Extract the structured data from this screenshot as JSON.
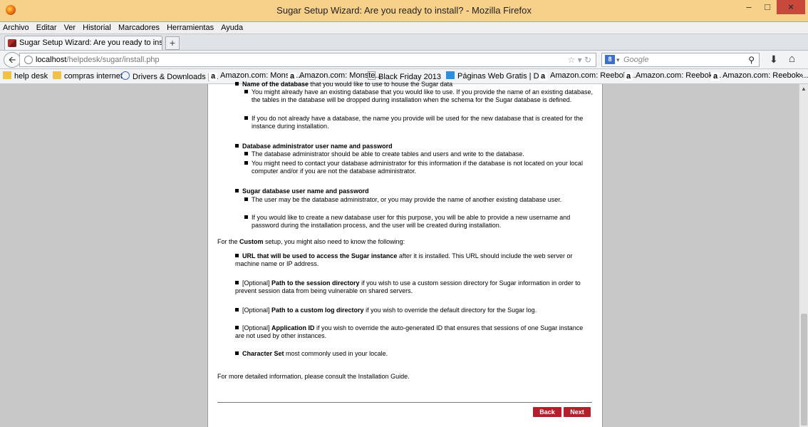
{
  "window": {
    "title": "Sugar Setup Wizard: Are you ready to install? - Mozilla Firefox"
  },
  "menu": [
    "Archivo",
    "Editar",
    "Ver",
    "Historial",
    "Marcadores",
    "Herramientas",
    "Ayuda"
  ],
  "tab": {
    "label": "Sugar Setup Wizard: Are you ready to ins..."
  },
  "nav": {
    "url_host": "localhost",
    "url_path": "/helpdesk/sugar/install.php",
    "search_placeholder": "Google"
  },
  "bookmarks": [
    "help desk",
    "compras internet",
    "Drivers & Downloads | ...",
    "Amazon.com: Monste...",
    "Amazon.com: Monste...",
    "Black Friday 2013",
    "Páginas Web Gratis | D...",
    "Amazon.com: Reebok ...",
    "Amazon.com: Reebok ...",
    "Amazon.com: Reebok ..."
  ],
  "doc": {
    "cut_top_bold": "Name of the database",
    "cut_top_rest": " that you would like to use to house the Sugar data",
    "db_items": [
      "You might already have an existing database that you would like to use. If you provide the name of an existing database, the tables in the database will be dropped during installation when the schema for the Sugar database is defined.",
      "If you do not already have a database, the name you provide will be used for the new database that is created for the instance during installation."
    ],
    "admin_heading": "Database administrator user name and password",
    "admin_items": [
      "The database administrator should be able to create tables and users and write to the database.",
      "You might need to contact your database administrator for this information if the database is not located on your local computer and/or if you are not the database administrator."
    ],
    "sugar_heading": "Sugar database user name and password",
    "sugar_items": [
      "The user may be the database administrator, or you may provide the name of another existing database user.",
      "If you would like to create a new database user for this purpose, you will be able to provide a new username and password during the installation process, and the user will be created during installation."
    ],
    "custom_intro_pre": "For the ",
    "custom_intro_bold": "Custom",
    "custom_intro_post": " setup, you might also need to know the following:",
    "url_bold": "URL that will be used to access the Sugar instance",
    "url_rest": " after it is installed. This URL should include the web server or machine name or IP address.",
    "session_opt": "[Optional] ",
    "session_bold": "Path to the session directory",
    "session_rest": " if you wish to use a custom session directory for Sugar information in order to prevent session data from being vulnerable on shared servers.",
    "log_opt": "[Optional] ",
    "log_bold": "Path to a custom log directory",
    "log_rest": " if you wish to override the default directory for the Sugar log.",
    "app_opt": "[Optional] ",
    "app_bold": "Application ID",
    "app_rest": " if you wish to override the auto-generated ID that ensures that sessions of one Sugar instance are not used by other instances.",
    "charset_bold": "Character Set",
    "charset_rest": " most commonly used in your locale.",
    "more_info": "For more detailed information, please consult the Installation Guide."
  },
  "buttons": {
    "back": "Back",
    "next": "Next"
  }
}
